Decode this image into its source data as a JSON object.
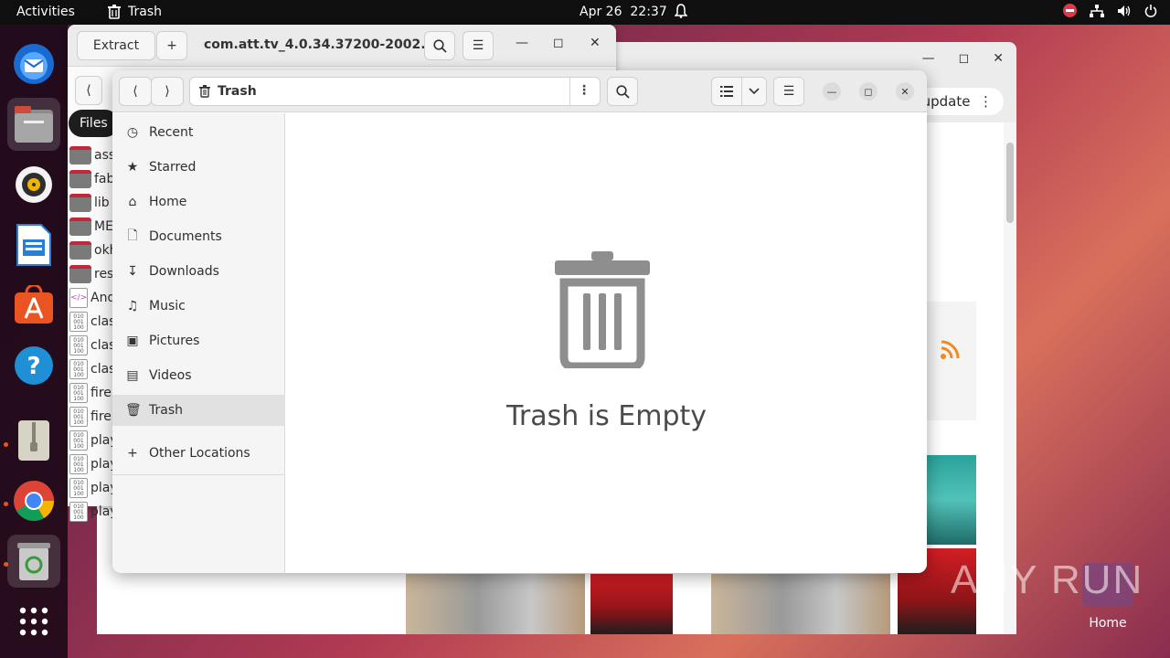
{
  "topbar": {
    "activities": "Activities",
    "app_name": "Trash",
    "date": "Apr 26",
    "time": "22:37"
  },
  "dock": {
    "tooltip": "Files",
    "items": [
      "thunderbird-icon",
      "files-icon",
      "rhythmbox-icon",
      "writer-icon",
      "software-icon",
      "help-icon",
      "archive-manager-icon",
      "chrome-icon",
      "trash-icon",
      "app-grid-icon"
    ]
  },
  "browser": {
    "refresh_label": "h update"
  },
  "archive": {
    "extract_label": "Extract",
    "title": "com.att.tv_4.0.34.37200-2002...",
    "rows": [
      {
        "label": "ass",
        "type": "folder"
      },
      {
        "label": "fab",
        "type": "folder"
      },
      {
        "label": "lib",
        "type": "folder"
      },
      {
        "label": "ME",
        "type": "folder"
      },
      {
        "label": "okh",
        "type": "folder"
      },
      {
        "label": "res",
        "type": "folder"
      },
      {
        "label": "And",
        "type": "xml"
      },
      {
        "label": "clas",
        "type": "bin"
      },
      {
        "label": "clas",
        "type": "bin"
      },
      {
        "label": "clas",
        "type": "bin"
      },
      {
        "label": "fire",
        "type": "bin"
      },
      {
        "label": "fire",
        "type": "bin"
      },
      {
        "label": "play",
        "type": "bin"
      },
      {
        "label": "play",
        "type": "bin"
      },
      {
        "label": "play",
        "type": "bin"
      },
      {
        "label": "play",
        "type": "bin"
      }
    ]
  },
  "files": {
    "path": "Trash",
    "sidebar": [
      {
        "label": "Recent",
        "icon": "recent-icon"
      },
      {
        "label": "Starred",
        "icon": "star-icon"
      },
      {
        "label": "Home",
        "icon": "home-icon"
      },
      {
        "label": "Documents",
        "icon": "documents-icon"
      },
      {
        "label": "Downloads",
        "icon": "downloads-icon"
      },
      {
        "label": "Music",
        "icon": "music-icon"
      },
      {
        "label": "Pictures",
        "icon": "pictures-icon"
      },
      {
        "label": "Videos",
        "icon": "videos-icon"
      },
      {
        "label": "Trash",
        "icon": "trash-icon"
      }
    ],
    "other_locations": "Other Locations",
    "empty_message": "Trash is Empty"
  },
  "desktop": {
    "home_label": "Home",
    "watermark": "ANY RUN"
  }
}
